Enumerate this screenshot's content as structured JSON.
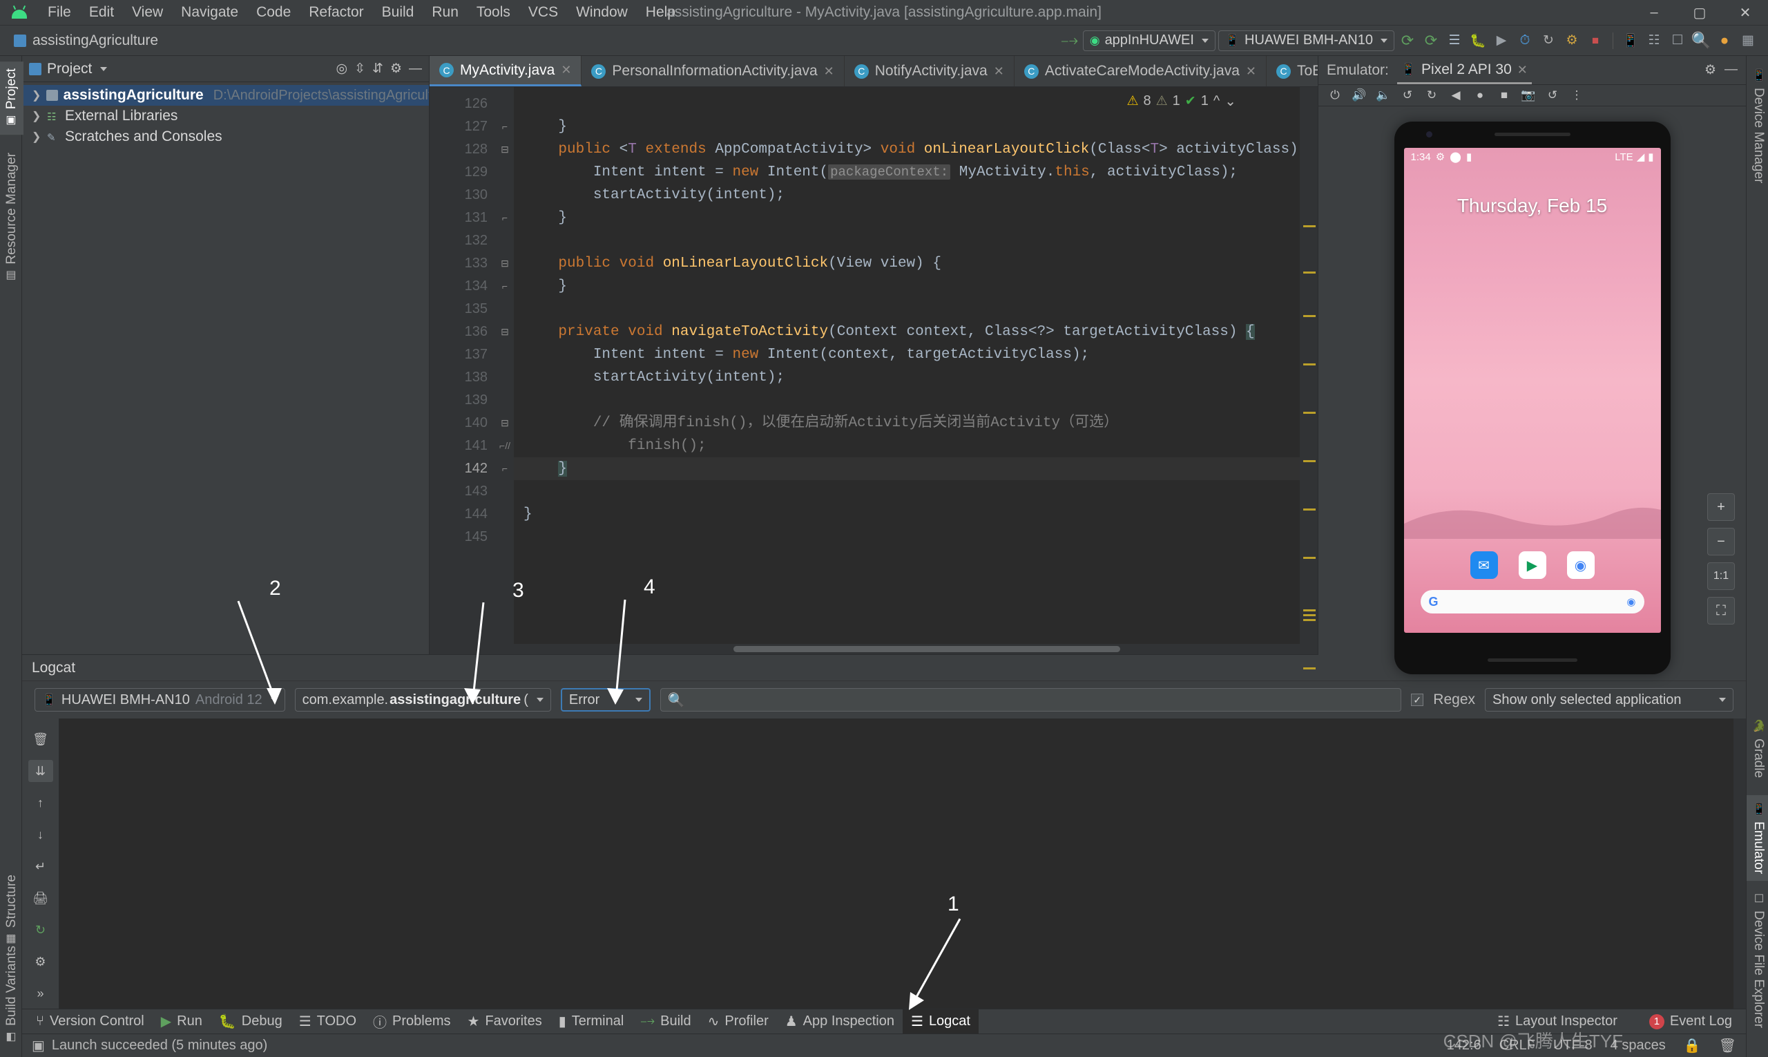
{
  "window": {
    "title": "assistingAgriculture - MyActivity.java [assistingAgriculture.app.main]",
    "minimize": "–",
    "maximize": "▢",
    "close": "✕"
  },
  "menu": {
    "items": [
      "File",
      "Edit",
      "View",
      "Navigate",
      "Code",
      "Refactor",
      "Build",
      "Run",
      "Tools",
      "VCS",
      "Window",
      "Help"
    ]
  },
  "toolbar": {
    "breadcrumb": "assistingAgriculture",
    "run_config": "appInHUAWEI",
    "device": "HUAWEI BMH-AN10",
    "icons": [
      "hammer-icon",
      "run-icon",
      "run-coverage-icon",
      "profile-icon",
      "debug-icon",
      "attach-debugger-icon",
      "restart-icon",
      "stop-icon",
      "avd-manager-icon",
      "sdk-manager-icon",
      "search-icon",
      "account-icon",
      "layout-icon"
    ]
  },
  "left_rail": {
    "items": [
      {
        "label": "Project",
        "icon": "project-icon",
        "selected": true
      },
      {
        "label": "Resource Manager",
        "icon": "resource-icon",
        "selected": false
      },
      {
        "label": "Structure",
        "icon": "structure-icon",
        "selected": false
      },
      {
        "label": "Build Variants",
        "icon": "variants-icon",
        "selected": false
      }
    ]
  },
  "right_rail": {
    "items": [
      {
        "label": "Device Manager",
        "icon": "device-manager-icon"
      },
      {
        "label": "Gradle",
        "icon": "gradle-icon"
      },
      {
        "label": "Emulator",
        "icon": "emulator-icon",
        "selected": true
      },
      {
        "label": "Device File Explorer",
        "icon": "device-file-icon"
      }
    ]
  },
  "project": {
    "title": "Project",
    "tree": [
      {
        "name": "assistingAgriculture",
        "path": "D:\\AndroidProjects\\assistingAgriculture",
        "selected": true,
        "bold": true,
        "icon": "module-icon"
      },
      {
        "name": "External Libraries",
        "path": "",
        "selected": false,
        "bold": false,
        "icon": "libraries-icon"
      },
      {
        "name": "Scratches and Consoles",
        "path": "",
        "selected": false,
        "bold": false,
        "icon": "scratches-icon"
      }
    ]
  },
  "editor": {
    "tabs": [
      {
        "label": "MyActivity.java",
        "active": true
      },
      {
        "label": "PersonalInformationActivity.java",
        "active": false
      },
      {
        "label": "NotifyActivity.java",
        "active": false
      },
      {
        "label": "ActivateCareModeActivity.java",
        "active": false
      },
      {
        "label": "ToBeDoneTo",
        "active": false
      }
    ],
    "inspection": {
      "warnings": "8",
      "weak_warnings": "1",
      "checks": "1"
    },
    "first_line": 126,
    "current_line": 142,
    "lines": [
      {
        "n": 126,
        "fold": "",
        "html": ""
      },
      {
        "n": 127,
        "fold": "collapse",
        "html": "    <span class='t'>}</span>"
      },
      {
        "n": 128,
        "fold": "expand",
        "html": "    <span class='k'>public</span> <span class='t'>&lt;</span><span class='g'>T</span> <span class='k'>extends</span> <span class='t'>AppCompatActivity&gt;</span> <span class='k'>void</span> <span class='f'>onLinearLayoutClick</span><span class='t'>(Class&lt;</span><span class='g'>T</span><span class='t'>&gt; activityClass) {</span>"
      },
      {
        "n": 129,
        "fold": "",
        "html": "        <span class='t'>Intent intent = </span><span class='k'>new</span><span class='t'> Intent(</span><span class='hint'>packageContext:</span><span class='t'> MyActivity.</span><span class='k'>this</span><span class='t'>, activityClass);</span>"
      },
      {
        "n": 130,
        "fold": "",
        "html": "        <span class='t'>startActivity(intent);</span>"
      },
      {
        "n": 131,
        "fold": "collapse",
        "html": "    <span class='t'>}</span>"
      },
      {
        "n": 132,
        "fold": "",
        "html": ""
      },
      {
        "n": 133,
        "fold": "expand",
        "html": "    <span class='k'>public</span> <span class='k'>void</span> <span class='f'>onLinearLayoutClick</span><span class='t'>(View view) {</span>"
      },
      {
        "n": 134,
        "fold": "collapse",
        "html": "    <span class='t'>}</span>"
      },
      {
        "n": 135,
        "fold": "",
        "html": ""
      },
      {
        "n": 136,
        "fold": "expand",
        "html": "    <span class='k'>private</span> <span class='k'>void</span> <span class='f'>navigateToActivity</span><span class='t'>(Context context, Class&lt;?&gt; targetActivityClass) </span><span class='brace-hl t'>{</span>"
      },
      {
        "n": 137,
        "fold": "",
        "html": "        <span class='t'>Intent intent = </span><span class='k'>new</span><span class='t'> Intent(context, targetActivityClass);</span>"
      },
      {
        "n": 138,
        "fold": "",
        "html": "        <span class='t'>startActivity(intent);</span>"
      },
      {
        "n": 139,
        "fold": "",
        "html": ""
      },
      {
        "n": 140,
        "fold": "expand",
        "html": "        <span class='c'>// 确保调用finish()，以便在启动新Activity后关闭当前Activity（可选）</span>"
      },
      {
        "n": 141,
        "fold": "collapse-comment",
        "html": "            <span class='c'>finish();</span>"
      },
      {
        "n": 142,
        "fold": "collapse",
        "html": "    <span class='brace-hl t'>}</span>",
        "current": true
      },
      {
        "n": 143,
        "fold": "",
        "html": ""
      },
      {
        "n": 144,
        "fold": "",
        "html": "<span class='t'>}</span>"
      },
      {
        "n": 145,
        "fold": "",
        "html": ""
      }
    ]
  },
  "emulator": {
    "label": "Emulator:",
    "tab": "Pixel 2 API 30",
    "toolbar_icons": [
      "power-icon",
      "volume-up-icon",
      "volume-down-icon",
      "rotate-left-icon",
      "rotate-right-icon",
      "back-icon",
      "home-icon",
      "overview-icon",
      "screenshot-icon",
      "snapshot-icon",
      "more-icon"
    ],
    "device": {
      "time": "1:34",
      "network": "LTE",
      "date_text": "Thursday, Feb 15",
      "dock_icons": [
        "messages-icon",
        "play-store-icon",
        "chrome-icon"
      ],
      "nav_back": "◀",
      "nav_home": "●",
      "nav_recent": "■"
    },
    "zoom_controls": {
      "zoom_in": "+",
      "zoom_out": "−",
      "actual_size": "1:1",
      "fit_screen": "⛶"
    }
  },
  "logcat": {
    "title": "Logcat",
    "device_filter": "HUAWEI BMH-AN10",
    "device_filter_os": "Android 12",
    "process_filter_prefix": "com.example.",
    "process_filter_bold": "assistingagriculture",
    "process_filter_suffix": " (",
    "level_filter": "Error",
    "search_placeholder": "",
    "search_icon": "search-icon",
    "regex_label": "Regex",
    "regex_checked": true,
    "scope_filter": "Show only selected application",
    "rail_icons": [
      "clear-icon",
      "scroll-end-icon",
      "up-icon",
      "down-icon",
      "soft-wrap-icon",
      "print-icon",
      "restart-icon",
      "settings-icon",
      "expand-icon"
    ],
    "output": ""
  },
  "bottom_bar": {
    "items": [
      {
        "label": "Version Control",
        "icon": "vcs-icon",
        "selected": false
      },
      {
        "label": "Run",
        "icon": "run-icon",
        "selected": false
      },
      {
        "label": "Debug",
        "icon": "debug-icon",
        "selected": false
      },
      {
        "label": "TODO",
        "icon": "todo-icon",
        "selected": false
      },
      {
        "label": "Problems",
        "icon": "problems-icon",
        "selected": false
      },
      {
        "label": "Favorites",
        "icon": "favorites-icon",
        "selected": false
      },
      {
        "label": "Terminal",
        "icon": "terminal-icon",
        "selected": false
      },
      {
        "label": "Build",
        "icon": "build-icon",
        "selected": false
      },
      {
        "label": "Profiler",
        "icon": "profiler-icon",
        "selected": false
      },
      {
        "label": "App Inspection",
        "icon": "app-inspection-icon",
        "selected": false
      },
      {
        "label": "Logcat",
        "icon": "logcat-icon",
        "selected": true
      }
    ],
    "layout_inspector": "Layout Inspector",
    "event_log": "Event Log",
    "event_log_count": "1"
  },
  "status_bar": {
    "message": "Launch succeeded (5 minutes ago)",
    "caret": "142:6",
    "line_sep": "CRLF",
    "encoding": "UTF-8",
    "indent": "4 spaces",
    "watermark": "CSDN @飞腾人生TYF"
  },
  "annotations": [
    {
      "label": "1"
    },
    {
      "label": "2"
    },
    {
      "label": "3"
    },
    {
      "label": "4"
    }
  ]
}
